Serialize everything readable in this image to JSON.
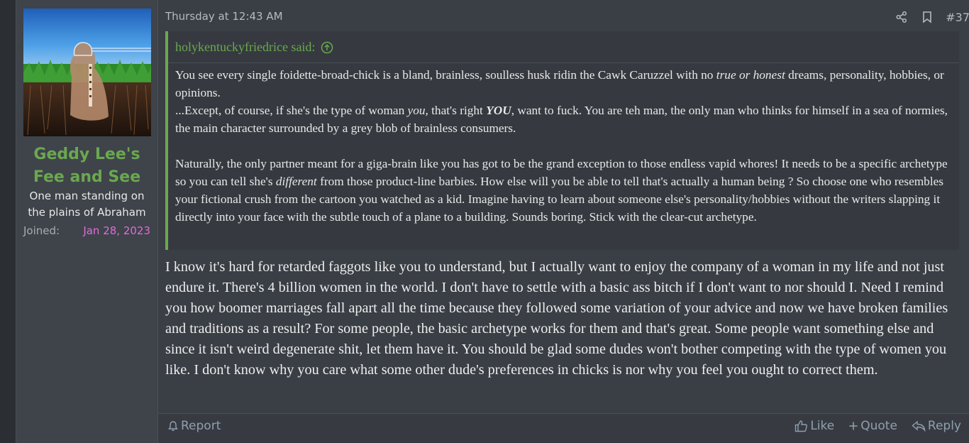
{
  "user": {
    "name": "Geddy Lee's Fee and See",
    "title_line1": "One man standing on",
    "title_line2": "the plains of Abraham",
    "joined_label": "Joined:",
    "joined_date": "Jan 28, 2023",
    "name_color": "#6aa84f",
    "joined_color": "#e06bdc"
  },
  "post": {
    "date": "Thursday at 12:43 AM",
    "number": "#37",
    "icons": [
      "share-icon",
      "bookmark-icon"
    ]
  },
  "quote": {
    "author": "holykentuckyfriedrice said:",
    "p1_a": "You see every single foidette-broad-chick is a bland, brainless, soulless husk ridin the Cawk Caruzzel with no ",
    "p1_em": "true or honest",
    "p1_b": " dreams, personality, hobbies, or opinions.",
    "p2_a": "...Except, of course, if she's the type of woman ",
    "p2_em": "you,",
    "p2_b": " that's right ",
    "p2_strong": "YOU",
    "p2_c": ", want to fuck. You are teh man, the only man who thinks for himself in a sea of normies, the main character surrounded by a grey blob of brainless consumers.",
    "p3_a": "Naturally, the only partner meant for a giga-brain like you has got to be the grand exception to those endless vapid whores! It needs to be a specific archetype so you can tell she's ",
    "p3_em": "different",
    "p3_b": " from those product-line barbies. How else will you be able to tell that's actually a human being ? So choose one who resembles your fictional crush from the cartoon you watched as a kid. Imagine having to learn about someone else's personality/hobbies without the writers slapping it directly into your face with the subtle touch of a plane to a building. Sounds boring. Stick with the clear-cut archetype."
  },
  "reply": {
    "text": "I know it's hard for retarded faggots like you to understand, but I actually want to enjoy the company of a woman in my life and not just endure it. There's 4 billion women in the world. I don't have to settle with a basic ass bitch if I don't want to nor should I. Need I remind you how boomer marriages fall apart all the time because they followed some variation of your advice and now we have broken families and traditions as a result? For some people, the basic archetype works for them and that's great. Some people want something else and since it isn't weird degenerate shit, let them have it. You should be glad some dudes won't bother competing with the type of women you like. I don't know why you care what some other dude's preferences in chicks is nor why you feel you ought to correct them."
  },
  "footer": {
    "report": "Report",
    "like": "Like",
    "quote": "Quote",
    "reply": "Reply"
  },
  "colors": {
    "accent_green": "#6aa84f",
    "background": "#3a3e45",
    "action_text": "#8f9faf"
  }
}
